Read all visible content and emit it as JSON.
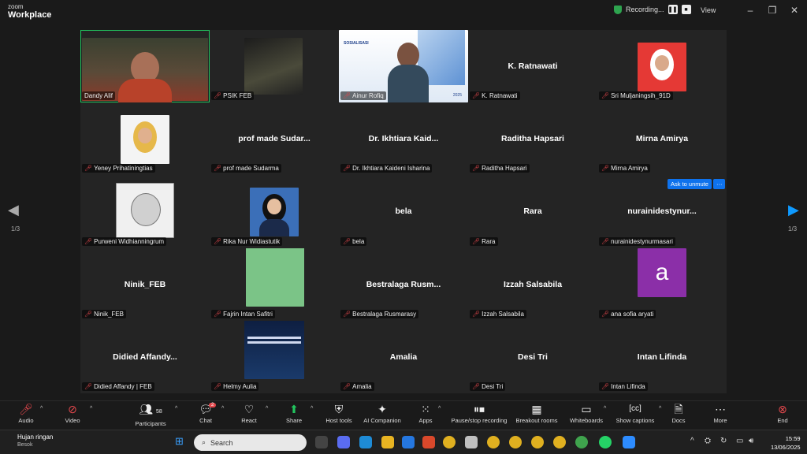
{
  "app": {
    "brand_top": "zoom",
    "brand_bottom": "Workplace",
    "recording_label": "Recording...",
    "view_label": "View"
  },
  "colors": {
    "accent": "#0e72ed",
    "active_border": "#22c55e",
    "muted_mic": "#e5484d",
    "recording_shield": "#2ea44f"
  },
  "grid": {
    "tiles": [
      {
        "name": "Dandy Alif",
        "center": "",
        "muted": false,
        "active": true,
        "video": "video-dandy"
      },
      {
        "name": "PSIK FEB",
        "center": "",
        "muted": true,
        "video": "video-psik"
      },
      {
        "name": "Ainur Rofiq",
        "center": "",
        "muted": true,
        "video": "video-ainur"
      },
      {
        "name": "K. Ratnawati",
        "center": "K. Ratnawati",
        "muted": true
      },
      {
        "name": "Sri Muljaningsih_91D",
        "center": "",
        "muted": true,
        "video": "photo-sri"
      },
      {
        "name": "Yeney Prihatiningtias",
        "center": "",
        "muted": true,
        "video": "photo-yeney"
      },
      {
        "name": "prof made Sudarma",
        "center": "prof made Sudar...",
        "muted": true
      },
      {
        "name": "Dr. Ikhtiara Kaideni Isharina",
        "center": "Dr. Ikhtiara Kaid...",
        "muted": true
      },
      {
        "name": "Raditha Hapsari",
        "center": "Raditha Hapsari",
        "muted": true
      },
      {
        "name": "Mirna Amirya",
        "center": "Mirna Amirya",
        "muted": true
      },
      {
        "name": "Purweni Widhianningrum",
        "center": "",
        "muted": true,
        "video": "photo-purweni"
      },
      {
        "name": "Rika Nur Widiastutik",
        "center": "",
        "muted": true,
        "video": "photo-rika"
      },
      {
        "name": "bela",
        "center": "bela",
        "muted": true
      },
      {
        "name": "Rara",
        "center": "Rara",
        "muted": true
      },
      {
        "name": "nurainidestynurmasari",
        "center": "nurainidestynur...",
        "muted": true
      },
      {
        "name": "Ninik_FEB",
        "center": "Ninik_FEB",
        "muted": true
      },
      {
        "name": "Fajrin Intan Safitri",
        "center": "",
        "muted": true,
        "video": "photo-fajrin"
      },
      {
        "name": "Bestralaga Rusmarasy",
        "center": "Bestralaga Rusm...",
        "muted": true
      },
      {
        "name": "Izzah Salsabila",
        "center": "Izzah Salsabila",
        "muted": true
      },
      {
        "name": "ana sofia aryati",
        "center": "",
        "muted": true,
        "video": "avatar-ana",
        "avatar_letter": "a"
      },
      {
        "name": "Didied  Affandy | FEB",
        "center": "Didied   Affandy...",
        "muted": true
      },
      {
        "name": "Helmy Aulia",
        "center": "",
        "muted": true,
        "video": "photo-helmy"
      },
      {
        "name": "Amalia",
        "center": "Amalia",
        "muted": true
      },
      {
        "name": "Desi Tri",
        "center": "Desi Tri",
        "muted": true
      },
      {
        "name": "Intan Lifinda",
        "center": "Intan Lifinda",
        "muted": true
      }
    ],
    "page_left": "1/3",
    "page_right": "1/3",
    "ask_unmute_label": "Ask to unmute",
    "more_label": "···",
    "slide_title": "SOSIALISASI",
    "slide_date": "2025"
  },
  "toolbar": {
    "audio": "Audio",
    "video": "Video",
    "participants": "Participants",
    "participants_count": "58",
    "chat": "Chat",
    "chat_badge": "2",
    "react": "React",
    "share": "Share",
    "host_tools": "Host tools",
    "ai_companion": "AI Companion",
    "apps": "Apps",
    "pause_recording": "Pause/stop recording",
    "breakout": "Breakout rooms",
    "whiteboards": "Whiteboards",
    "captions": "Show captions",
    "docs": "Docs",
    "more": "More",
    "end": "End"
  },
  "taskbar": {
    "weather_title": "Hujan ringan",
    "weather_sub": "Besok",
    "search_placeholder": "Search",
    "time": "15:59",
    "date": "13/06/2025"
  }
}
